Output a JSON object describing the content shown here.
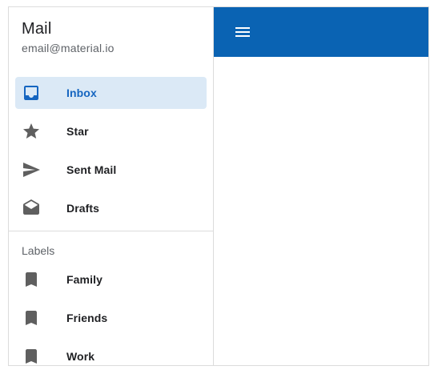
{
  "drawer": {
    "title": "Mail",
    "subtitle": "email@material.io",
    "items": [
      {
        "label": "Inbox",
        "icon": "inbox-icon",
        "active": true
      },
      {
        "label": "Star",
        "icon": "star-icon"
      },
      {
        "label": "Sent Mail",
        "icon": "send-icon"
      },
      {
        "label": "Drafts",
        "icon": "drafts-icon"
      }
    ],
    "labels_header": "Labels",
    "labels": [
      {
        "label": "Family",
        "icon": "bookmark-icon"
      },
      {
        "label": "Friends",
        "icon": "bookmark-icon"
      },
      {
        "label": "Work",
        "icon": "bookmark-icon"
      }
    ]
  },
  "app_bar": {
    "menu_icon": "menu-icon",
    "color": "#0a63b3"
  },
  "colors": {
    "accent": "#1565c0",
    "active_bg": "#dbe9f6"
  }
}
